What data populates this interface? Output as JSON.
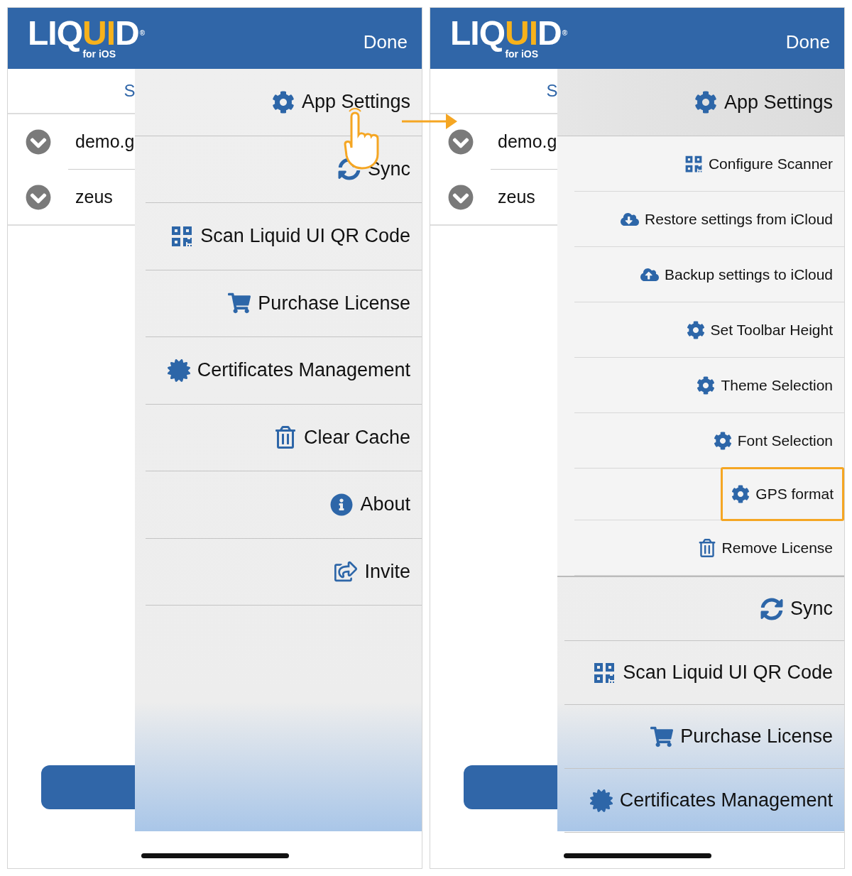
{
  "screens": [
    {
      "header": {
        "logo": {
          "parts": [
            {
              "text": "LIQ",
              "accent": false
            },
            {
              "text": "UI",
              "accent": true
            },
            {
              "text": "D",
              "accent": false
            }
          ],
          "mark": "®",
          "sub": "for iOS"
        },
        "done": "Done"
      },
      "list": {
        "heading": "S",
        "rows": [
          {
            "label": "demo.g"
          },
          {
            "label": "zeus"
          }
        ]
      },
      "menu": [
        {
          "kind": "settings",
          "label": "App Settings",
          "selected": false,
          "tapped": true
        },
        {
          "kind": "sync",
          "label": "Sync",
          "selected": false,
          "tapped": false
        },
        {
          "kind": "scan",
          "label": "Scan Liquid UI QR Code",
          "selected": false,
          "tapped": false
        },
        {
          "kind": "cart",
          "label": "Purchase License",
          "selected": false,
          "tapped": false
        },
        {
          "kind": "certificate",
          "label": "Certificates Management",
          "selected": false,
          "tapped": false
        },
        {
          "kind": "trash",
          "label": "Clear Cache",
          "selected": false,
          "tapped": false
        },
        {
          "kind": "info",
          "label": "About",
          "selected": false,
          "tapped": false
        },
        {
          "kind": "share",
          "label": "Invite",
          "selected": false,
          "tapped": false
        }
      ]
    },
    {
      "header": {
        "logo": {
          "parts": [
            {
              "text": "LIQ",
              "accent": false
            },
            {
              "text": "UI",
              "accent": true
            },
            {
              "text": "D",
              "accent": false
            }
          ],
          "mark": "®",
          "sub": "for iOS"
        },
        "done": "Done"
      },
      "list": {
        "heading": "S",
        "rows": [
          {
            "label": "demo.g"
          },
          {
            "label": "zeus"
          }
        ]
      },
      "menu": [
        {
          "kind": "settings",
          "label": "App Settings",
          "selected": true,
          "tapped": false,
          "children": [
            {
              "kind": "scan",
              "label": "Configure Scanner",
              "highlighted": false
            },
            {
              "kind": "download",
              "label": "Restore settings from iCloud",
              "highlighted": false
            },
            {
              "kind": "upload",
              "label": "Backup settings to iCloud",
              "highlighted": false
            },
            {
              "kind": "settings",
              "label": "Set Toolbar Height",
              "highlighted": false
            },
            {
              "kind": "settings",
              "label": "Theme Selection",
              "highlighted": false
            },
            {
              "kind": "settings",
              "label": "Font Selection",
              "highlighted": false
            },
            {
              "kind": "settings",
              "label": "GPS format",
              "highlighted": true
            },
            {
              "kind": "trash",
              "label": "Remove License",
              "highlighted": false
            }
          ]
        },
        {
          "kind": "sync",
          "label": "Sync",
          "selected": false,
          "tapped": false
        },
        {
          "kind": "scan",
          "label": "Scan Liquid UI QR Code",
          "selected": false,
          "tapped": false
        },
        {
          "kind": "cart",
          "label": "Purchase License",
          "selected": false,
          "tapped": false
        },
        {
          "kind": "certificate",
          "label": "Certificates Management",
          "selected": false,
          "tapped": false
        }
      ]
    }
  ]
}
